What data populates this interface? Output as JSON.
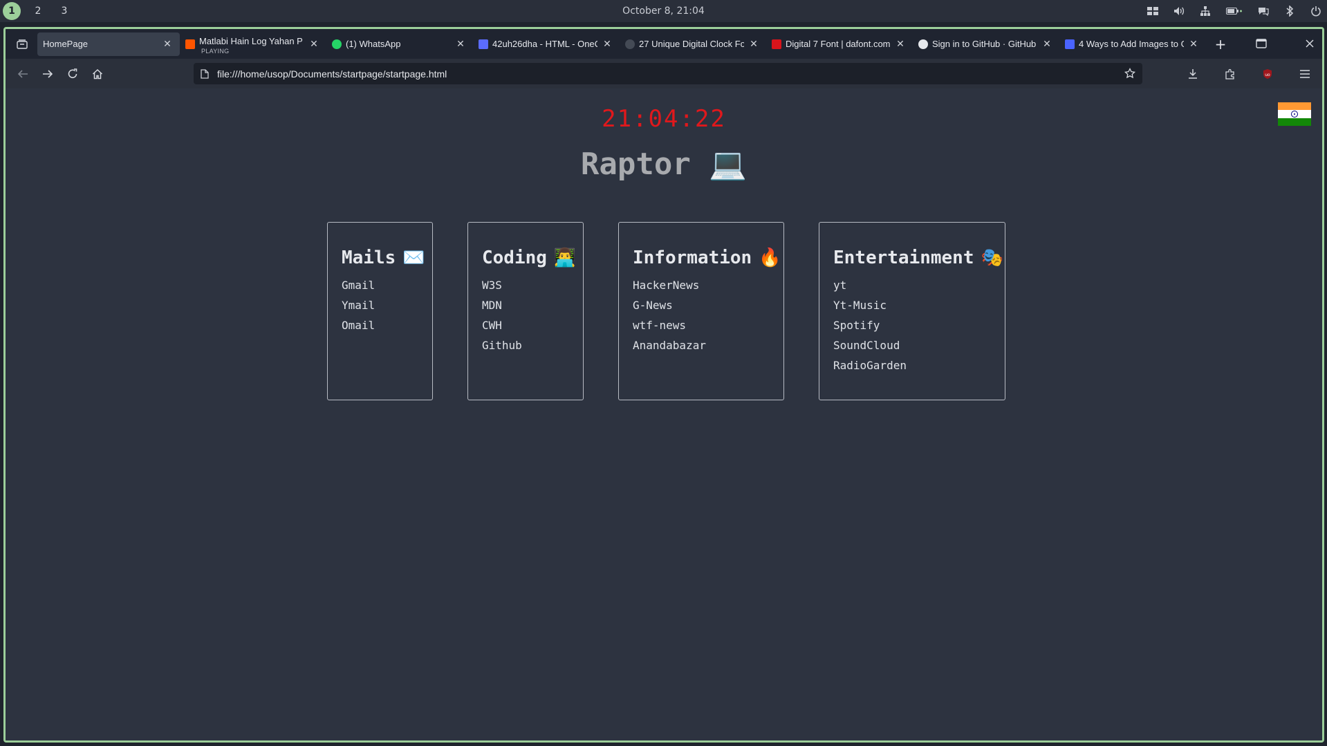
{
  "system_bar": {
    "workspaces": [
      "1",
      "2",
      "3"
    ],
    "active_workspace": "1",
    "datetime": "October 8, 21:04"
  },
  "tabs": [
    {
      "title": "HomePage",
      "active": true,
      "favicon_color": "#39404d"
    },
    {
      "title": "Matlabi Hain Log Yahan P",
      "subtitle": "PLAYING",
      "favicon_color": "#ff5500"
    },
    {
      "title": "(1) WhatsApp",
      "favicon_color": "#25d366"
    },
    {
      "title": "42uh26dha - HTML - OneC",
      "favicon_color": "#5b6cff"
    },
    {
      "title": "27 Unique Digital Clock Fo",
      "favicon_color": "#444a55"
    },
    {
      "title": "Digital 7 Font | dafont.com",
      "favicon_color": "#d8141b"
    },
    {
      "title": "Sign in to GitHub · GitHub",
      "favicon_color": "#e6e8ec"
    },
    {
      "title": "4 Ways to Add Images to G",
      "favicon_color": "#4a63ff"
    }
  ],
  "navbar": {
    "url": "file:///home/usop/Documents/startpage/startpage.html"
  },
  "page": {
    "clock": "21:04:22",
    "title": "Raptor",
    "title_emoji": "💻",
    "cards": [
      {
        "title": "Mails",
        "emoji": "✉️",
        "links": [
          "Gmail",
          "Ymail",
          "Omail"
        ]
      },
      {
        "title": "Coding",
        "emoji": "👨‍💻",
        "links": [
          "W3S",
          "MDN",
          "CWH",
          "Github"
        ]
      },
      {
        "title": "Information",
        "emoji": "🔥",
        "links": [
          "HackerNews",
          "G-News",
          "wtf-news",
          "Anandabazar"
        ]
      },
      {
        "title": "Entertainment",
        "emoji": "🎭",
        "links": [
          "yt",
          "Yt-Music",
          "Spotify",
          "SoundCloud",
          "RadioGarden"
        ]
      }
    ]
  },
  "colors": {
    "accent_border": "#9ccf9a",
    "clock_red": "#e0181c",
    "page_bg": "#2d3340"
  }
}
